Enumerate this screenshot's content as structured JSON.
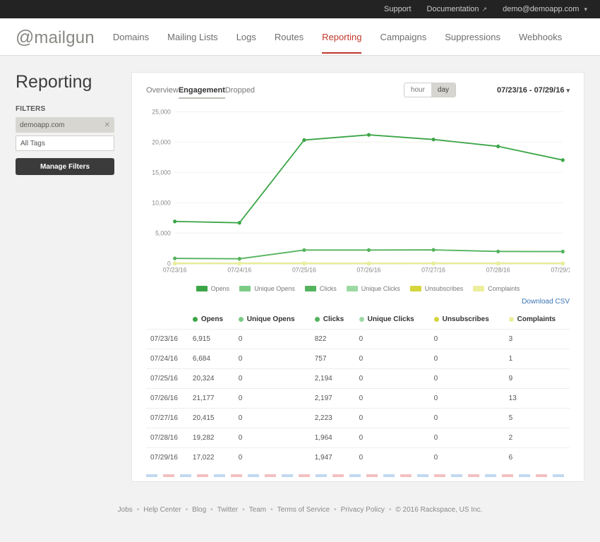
{
  "topbar": {
    "support": "Support",
    "docs": "Documentation",
    "account": "demo@demoapp.com"
  },
  "nav": {
    "items": [
      "Domains",
      "Mailing Lists",
      "Logs",
      "Routes",
      "Reporting",
      "Campaigns",
      "Suppressions",
      "Webhooks"
    ],
    "active": "Reporting"
  },
  "page": {
    "title": "Reporting"
  },
  "filters": {
    "label": "FILTERS",
    "domain": "demoapp.com",
    "tags": "All Tags",
    "manage": "Manage Filters"
  },
  "tabs": {
    "items": [
      "Overview",
      "Engagement",
      "Dropped"
    ],
    "active": "Engagement"
  },
  "granularity": {
    "items": [
      "hour",
      "day"
    ],
    "active": "day"
  },
  "dateRange": "07/23/16 - 07/29/16",
  "download": "Download CSV",
  "columns": [
    "Opens",
    "Unique Opens",
    "Clicks",
    "Unique Clicks",
    "Unsubscribes",
    "Complaints"
  ],
  "colors": {
    "opens": "#3ba547",
    "uopens": "#7bcb85",
    "clicks": "#54b35d",
    "uclicks": "#9cd9a3",
    "unsubs": "#d4d63c",
    "complaints": "#ecee9c"
  },
  "chart_data": {
    "type": "line",
    "categories": [
      "07/23/16",
      "07/24/16",
      "07/25/16",
      "07/26/16",
      "07/27/16",
      "07/28/16",
      "07/29/16"
    ],
    "series": [
      {
        "name": "Opens",
        "color": "#3ba547",
        "values": [
          6915,
          6684,
          20324,
          21177,
          20415,
          19282,
          17022
        ]
      },
      {
        "name": "Unique Opens",
        "color": "#7bcb85",
        "values": [
          0,
          0,
          0,
          0,
          0,
          0,
          0
        ]
      },
      {
        "name": "Clicks",
        "color": "#54b35d",
        "values": [
          822,
          757,
          2194,
          2197,
          2223,
          1964,
          1947
        ]
      },
      {
        "name": "Unique Clicks",
        "color": "#9cd9a3",
        "values": [
          0,
          0,
          0,
          0,
          0,
          0,
          0
        ]
      },
      {
        "name": "Unsubscribes",
        "color": "#d4d63c",
        "values": [
          0,
          0,
          0,
          0,
          0,
          0,
          0
        ]
      },
      {
        "name": "Complaints",
        "color": "#ecee9c",
        "values": [
          3,
          1,
          9,
          13,
          5,
          2,
          6
        ]
      }
    ],
    "ylim": [
      0,
      25000
    ],
    "yticks": [
      0,
      5000,
      10000,
      15000,
      20000,
      25000
    ],
    "xlabel": "",
    "ylabel": ""
  },
  "table": {
    "rows": [
      {
        "date": "07/23/16",
        "opens": "6,915",
        "uopens": "0",
        "clicks": "822",
        "uclicks": "0",
        "unsubs": "0",
        "complaints": "3"
      },
      {
        "date": "07/24/16",
        "opens": "6,684",
        "uopens": "0",
        "clicks": "757",
        "uclicks": "0",
        "unsubs": "0",
        "complaints": "1"
      },
      {
        "date": "07/25/16",
        "opens": "20,324",
        "uopens": "0",
        "clicks": "2,194",
        "uclicks": "0",
        "unsubs": "0",
        "complaints": "9"
      },
      {
        "date": "07/26/16",
        "opens": "21,177",
        "uopens": "0",
        "clicks": "2,197",
        "uclicks": "0",
        "unsubs": "0",
        "complaints": "13"
      },
      {
        "date": "07/27/16",
        "opens": "20,415",
        "uopens": "0",
        "clicks": "2,223",
        "uclicks": "0",
        "unsubs": "0",
        "complaints": "5"
      },
      {
        "date": "07/28/16",
        "opens": "19,282",
        "uopens": "0",
        "clicks": "1,964",
        "uclicks": "0",
        "unsubs": "0",
        "complaints": "2"
      },
      {
        "date": "07/29/16",
        "opens": "17,022",
        "uopens": "0",
        "clicks": "1,947",
        "uclicks": "0",
        "unsubs": "0",
        "complaints": "6"
      }
    ]
  },
  "footer": {
    "links": [
      "Jobs",
      "Help Center",
      "Blog",
      "Twitter",
      "Team",
      "Terms of Service",
      "Privacy Policy"
    ],
    "copyright": "© 2016 Rackspace, US Inc."
  }
}
